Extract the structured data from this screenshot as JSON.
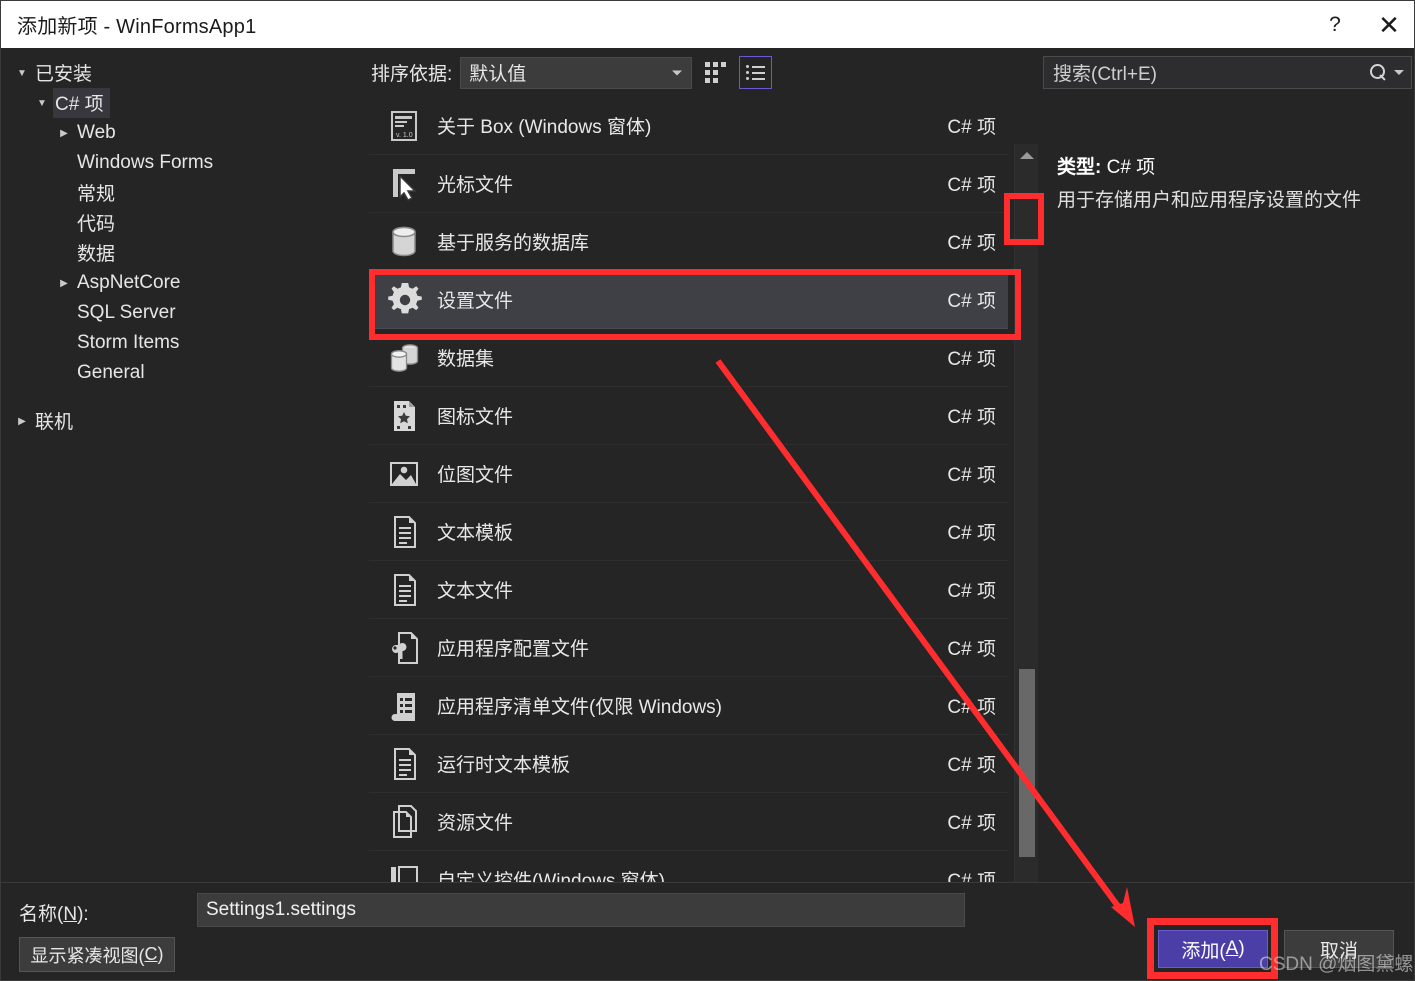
{
  "window": {
    "title": "添加新项 - WinFormsApp1",
    "help_label": "?",
    "close_label": "✕"
  },
  "sidebar": {
    "items": [
      {
        "label": "已安装",
        "level": 0,
        "twisty": "expanded",
        "selected": false
      },
      {
        "label": "C# 项",
        "level": 1,
        "twisty": "expanded",
        "selected": true
      },
      {
        "label": "Web",
        "level": 2,
        "twisty": "collapsed",
        "selected": false
      },
      {
        "label": "Windows Forms",
        "level": 2,
        "twisty": "none",
        "selected": false
      },
      {
        "label": "常规",
        "level": 2,
        "twisty": "none",
        "selected": false
      },
      {
        "label": "代码",
        "level": 2,
        "twisty": "none",
        "selected": false
      },
      {
        "label": "数据",
        "level": 2,
        "twisty": "none",
        "selected": false
      },
      {
        "label": "AspNetCore",
        "level": 2,
        "twisty": "collapsed",
        "selected": false
      },
      {
        "label": "SQL Server",
        "level": 2,
        "twisty": "none",
        "selected": false
      },
      {
        "label": "Storm Items",
        "level": 2,
        "twisty": "none",
        "selected": false
      },
      {
        "label": "General",
        "level": 2,
        "twisty": "none",
        "selected": false
      },
      {
        "label": "联机",
        "level": 0,
        "twisty": "collapsed",
        "selected": false
      }
    ]
  },
  "toolbar": {
    "sort_label": "排序依据:",
    "sort_value": "默认值",
    "grid_view_icon": "grid-view-icon",
    "list_view_icon": "list-view-icon",
    "active_view": "list"
  },
  "search": {
    "placeholder": "搜索(Ctrl+E)",
    "value": "",
    "icon": "search-icon",
    "dropdown_icon": "chevron-down-icon"
  },
  "list": {
    "items": [
      {
        "name": "关于 Box (Windows 窗体)",
        "type": "C# 项",
        "icon": "about-box-icon",
        "selected": false
      },
      {
        "name": "光标文件",
        "type": "C# 项",
        "icon": "cursor-file-icon",
        "selected": false
      },
      {
        "name": "基于服务的数据库",
        "type": "C# 项",
        "icon": "database-icon",
        "selected": false
      },
      {
        "name": "设置文件",
        "type": "C# 项",
        "icon": "settings-gear-icon",
        "selected": true
      },
      {
        "name": "数据集",
        "type": "C# 项",
        "icon": "dataset-icon",
        "selected": false
      },
      {
        "name": "图标文件",
        "type": "C# 项",
        "icon": "icon-file-icon",
        "selected": false
      },
      {
        "name": "位图文件",
        "type": "C# 项",
        "icon": "bitmap-file-icon",
        "selected": false
      },
      {
        "name": "文本模板",
        "type": "C# 项",
        "icon": "text-template-icon",
        "selected": false
      },
      {
        "name": "文本文件",
        "type": "C# 项",
        "icon": "text-file-icon",
        "selected": false
      },
      {
        "name": "应用程序配置文件",
        "type": "C# 项",
        "icon": "app-config-icon",
        "selected": false
      },
      {
        "name": "应用程序清单文件(仅限 Windows)",
        "type": "C# 项",
        "icon": "app-manifest-icon",
        "selected": false
      },
      {
        "name": "运行时文本模板",
        "type": "C# 项",
        "icon": "runtime-text-template-icon",
        "selected": false
      },
      {
        "name": "资源文件",
        "type": "C# 项",
        "icon": "resource-file-icon",
        "selected": false
      },
      {
        "name": "自定义控件(Windows 窗体)",
        "type": "C# 项",
        "icon": "custom-control-icon",
        "selected": false
      }
    ]
  },
  "details": {
    "type_label": "类型:",
    "type_value": "C# 项",
    "description": "用于存储用户和应用程序设置的文件"
  },
  "footer": {
    "name_label_pre": "名称(",
    "name_label_key": "N",
    "name_label_post": "):",
    "name_value": "Settings1.settings",
    "compact_view_pre": "显示紧凑视图(",
    "compact_view_key": "C",
    "compact_view_post": ")",
    "add_pre": "添加(",
    "add_key": "A",
    "add_post": ")",
    "cancel_label": "取消"
  },
  "annotations": {
    "highlight_color": "#ff2d2d",
    "accent_color": "#6a5acd",
    "watermark": "CSDN @烟图黛螺"
  }
}
